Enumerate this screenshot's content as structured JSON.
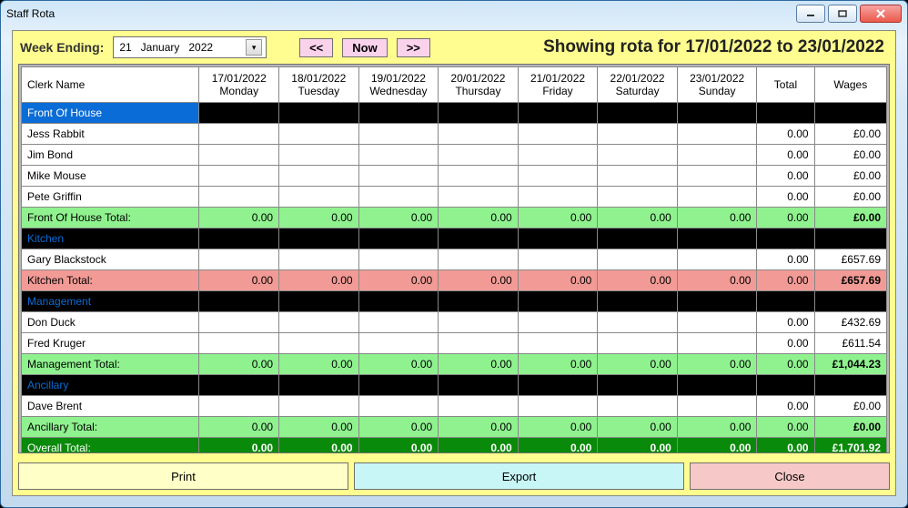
{
  "window": {
    "title": "Staff Rota"
  },
  "topbar": {
    "week_ending_label": "Week Ending:",
    "date": {
      "day": "21",
      "month": "January",
      "year": "2022"
    },
    "prev": "<<",
    "now": "Now",
    "next": ">>",
    "showing": "Showing rota for 17/01/2022 to 23/01/2022"
  },
  "header": {
    "name": "Clerk Name",
    "days": [
      {
        "date": "17/01/2022",
        "dow": "Monday"
      },
      {
        "date": "18/01/2022",
        "dow": "Tuesday"
      },
      {
        "date": "19/01/2022",
        "dow": "Wednesday"
      },
      {
        "date": "20/01/2022",
        "dow": "Thursday"
      },
      {
        "date": "21/01/2022",
        "dow": "Friday"
      },
      {
        "date": "22/01/2022",
        "dow": "Saturday"
      },
      {
        "date": "23/01/2022",
        "dow": "Sunday"
      }
    ],
    "total": "Total",
    "wages": "Wages"
  },
  "rows": [
    {
      "kind": "section",
      "foh": true,
      "cells": [
        "Front Of House",
        "",
        "",
        "",
        "",
        "",
        "",
        "",
        "",
        ""
      ]
    },
    {
      "kind": "data",
      "cells": [
        "Jess Rabbit",
        "",
        "",
        "",
        "",
        "",
        "",
        "",
        "0.00",
        "£0.00"
      ]
    },
    {
      "kind": "data",
      "cells": [
        "Jim Bond",
        "",
        "",
        "",
        "",
        "",
        "",
        "",
        "0.00",
        "£0.00"
      ]
    },
    {
      "kind": "data",
      "cells": [
        "Mike Mouse",
        "",
        "",
        "",
        "",
        "",
        "",
        "",
        "0.00",
        "£0.00"
      ]
    },
    {
      "kind": "data",
      "cells": [
        "Pete Griffin",
        "",
        "",
        "",
        "",
        "",
        "",
        "",
        "0.00",
        "£0.00"
      ]
    },
    {
      "kind": "total",
      "cells": [
        "Front Of House Total:",
        "0.00",
        "0.00",
        "0.00",
        "0.00",
        "0.00",
        "0.00",
        "0.00",
        "0.00",
        "£0.00"
      ]
    },
    {
      "kind": "section",
      "cells": [
        "Kitchen",
        "",
        "",
        "",
        "",
        "",
        "",
        "",
        "",
        ""
      ]
    },
    {
      "kind": "data",
      "cells": [
        "Gary Blackstock",
        "",
        "",
        "",
        "",
        "",
        "",
        "",
        "0.00",
        "£657.69"
      ]
    },
    {
      "kind": "total",
      "variant": "red",
      "cells": [
        "Kitchen Total:",
        "0.00",
        "0.00",
        "0.00",
        "0.00",
        "0.00",
        "0.00",
        "0.00",
        "0.00",
        "£657.69"
      ]
    },
    {
      "kind": "section",
      "cells": [
        "Management",
        "",
        "",
        "",
        "",
        "",
        "",
        "",
        "",
        ""
      ]
    },
    {
      "kind": "data",
      "cells": [
        "Don Duck",
        "",
        "",
        "",
        "",
        "",
        "",
        "",
        "0.00",
        "£432.69"
      ]
    },
    {
      "kind": "data",
      "cells": [
        "Fred Kruger",
        "",
        "",
        "",
        "",
        "",
        "",
        "",
        "0.00",
        "£611.54"
      ]
    },
    {
      "kind": "total",
      "cells": [
        "Management Total:",
        "0.00",
        "0.00",
        "0.00",
        "0.00",
        "0.00",
        "0.00",
        "0.00",
        "0.00",
        "£1,044.23"
      ]
    },
    {
      "kind": "section",
      "cells": [
        "Ancillary",
        "",
        "",
        "",
        "",
        "",
        "",
        "",
        "",
        ""
      ]
    },
    {
      "kind": "data",
      "cells": [
        "Dave Brent",
        "",
        "",
        "",
        "",
        "",
        "",
        "",
        "0.00",
        "£0.00"
      ]
    },
    {
      "kind": "total",
      "cells": [
        "Ancillary Total:",
        "0.00",
        "0.00",
        "0.00",
        "0.00",
        "0.00",
        "0.00",
        "0.00",
        "0.00",
        "£0.00"
      ]
    },
    {
      "kind": "overall",
      "cells": [
        "Overall Total:",
        "0.00",
        "0.00",
        "0.00",
        "0.00",
        "0.00",
        "0.00",
        "0.00",
        "0.00",
        "£1,701.92"
      ]
    }
  ],
  "footer": {
    "print": "Print",
    "export": "Export",
    "close": "Close"
  }
}
